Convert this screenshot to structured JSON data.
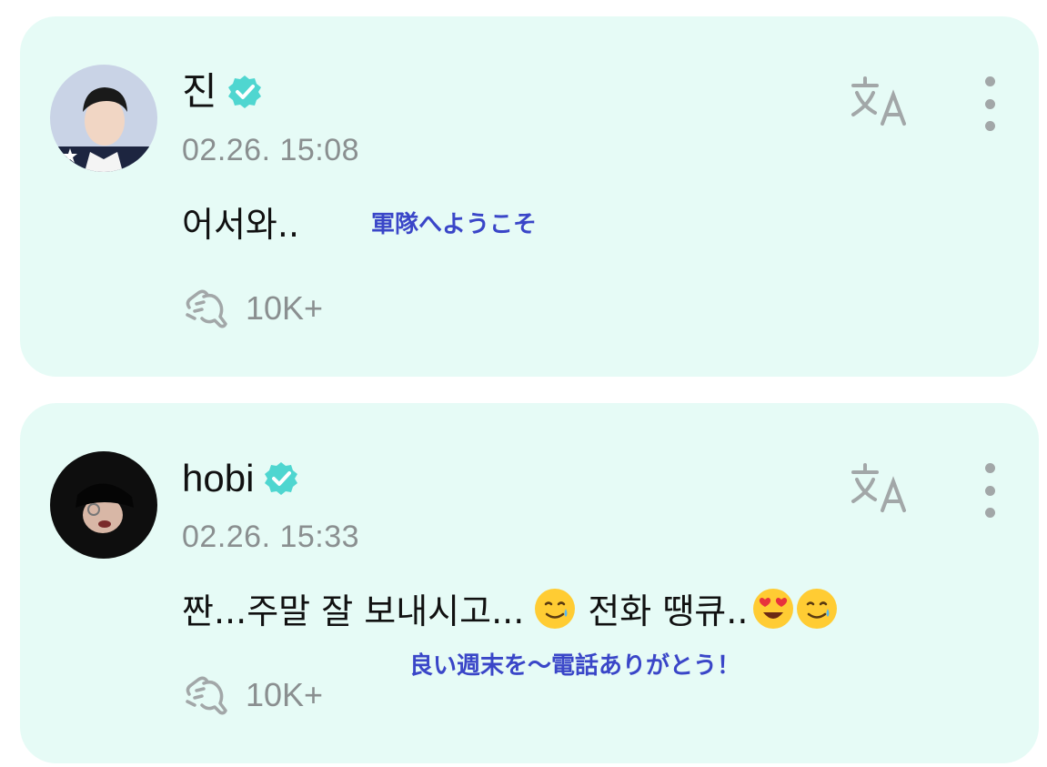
{
  "posts": [
    {
      "author": "진",
      "timestamp": "02.26. 15:08",
      "message": "어서와..",
      "translation_note": "軍隊へようこそ",
      "like_count": "10K+"
    },
    {
      "author": "hobi",
      "timestamp": "02.26. 15:33",
      "message_part1": "짠...주말 잘 보내시고...",
      "message_part2": "전화 땡큐..",
      "translation_note": "良い週末を～電話ありがとう！",
      "like_count": "10K+"
    }
  ],
  "icons": {
    "verified": "verified-badge-icon",
    "translate": "translate-icon",
    "more": "more-vertical-icon",
    "like": "cheer-hand-icon"
  },
  "colors": {
    "card_background": "#e6fbf6",
    "verified": "#4fd6d0",
    "translation_note": "#3a46c8",
    "meta_text": "#8a8f90"
  }
}
